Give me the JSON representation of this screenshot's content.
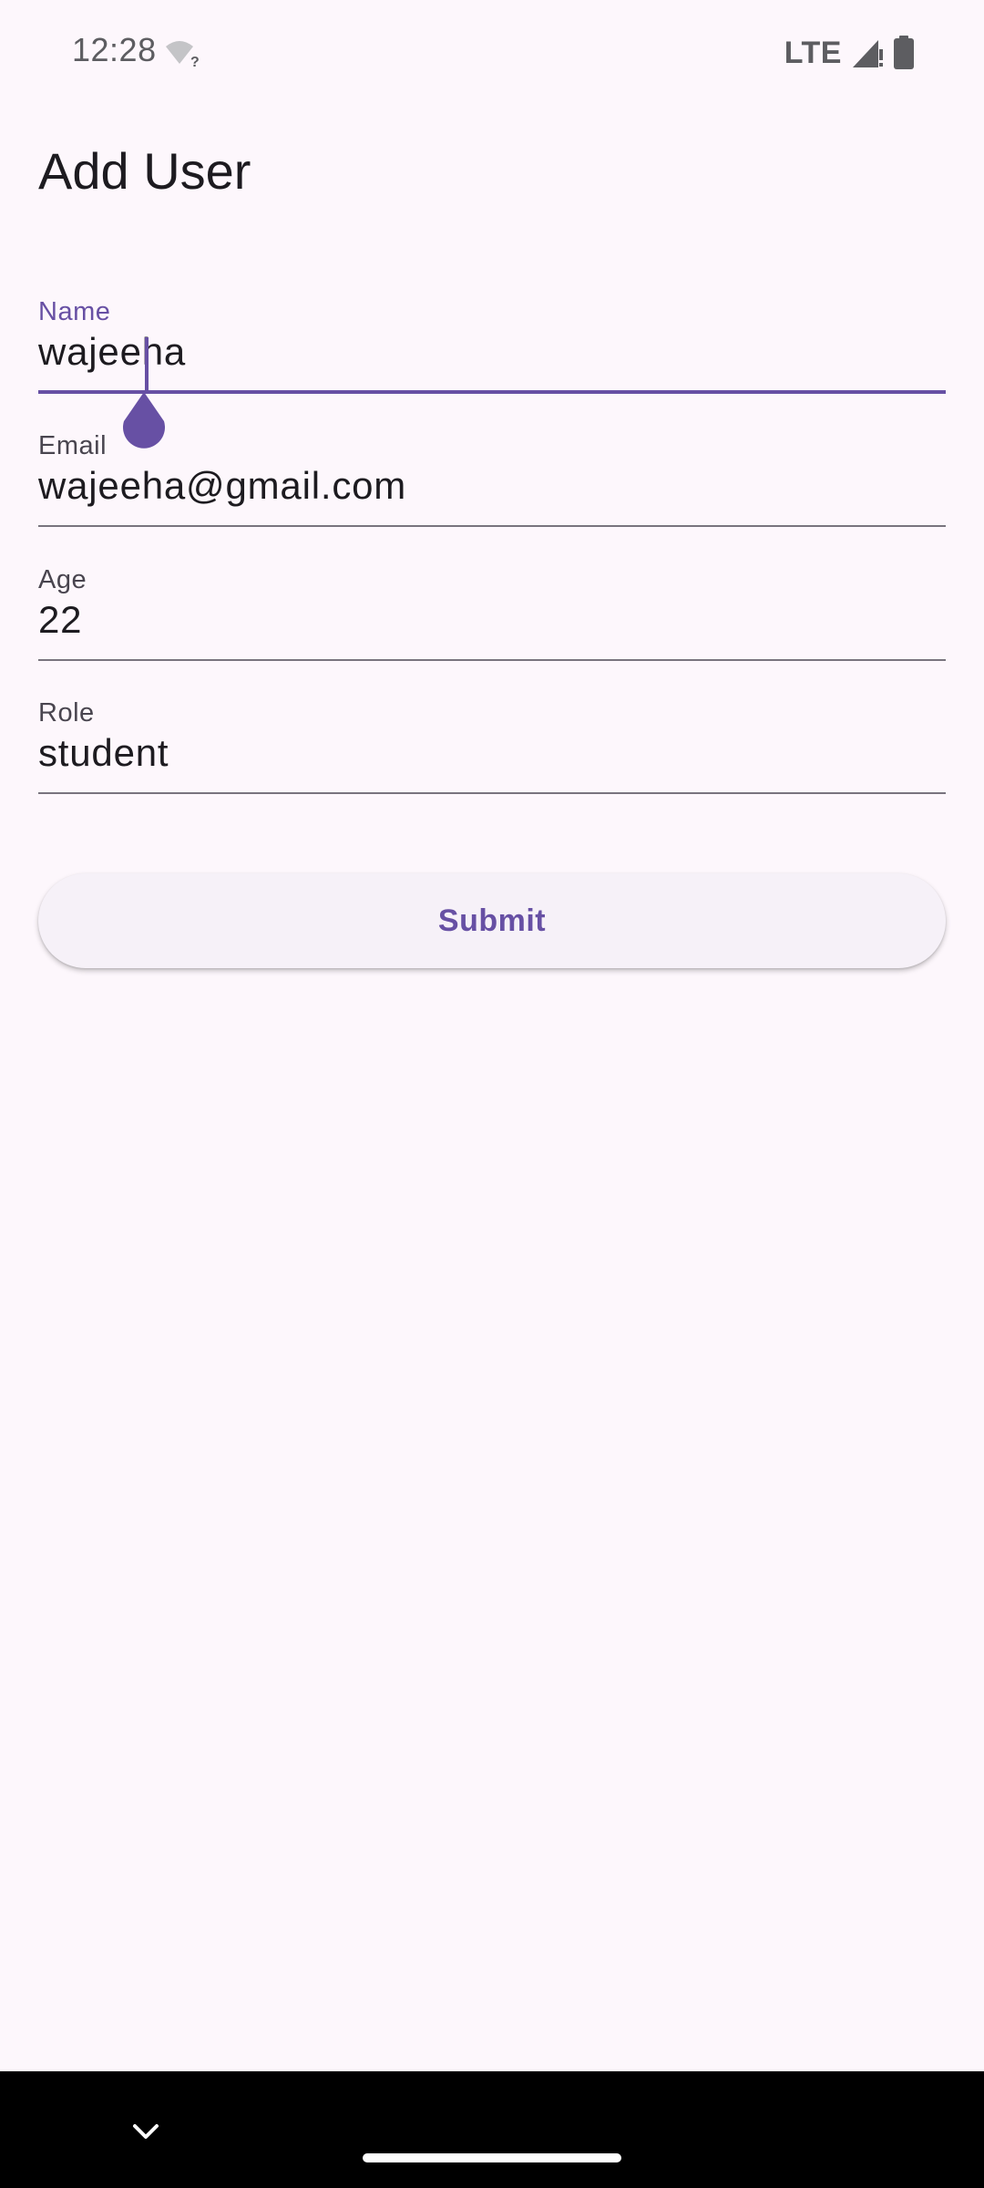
{
  "status_bar": {
    "time": "12:28",
    "network": "LTE",
    "icons": [
      "wifi-question-icon",
      "signal-icon",
      "battery-icon"
    ]
  },
  "page": {
    "title": "Add User"
  },
  "form": {
    "fields": [
      {
        "label": "Name",
        "value": "wajeeha",
        "focused": true
      },
      {
        "label": "Email",
        "value": "wajeeha@gmail.com",
        "focused": false
      },
      {
        "label": "Age",
        "value": "22",
        "focused": false
      },
      {
        "label": "Role",
        "value": "student",
        "focused": false
      }
    ],
    "submit_label": "Submit"
  },
  "nav_bar": {
    "icons": [
      "chevron-down-icon",
      "home-pill"
    ]
  },
  "colors": {
    "background": "#fdf7fc",
    "accent": "#6750a4",
    "text": "#1d1b20",
    "label": "#49454f",
    "underline": "#79747e",
    "button_bg": "#f6f1f8",
    "nav_bar": "#000000"
  }
}
